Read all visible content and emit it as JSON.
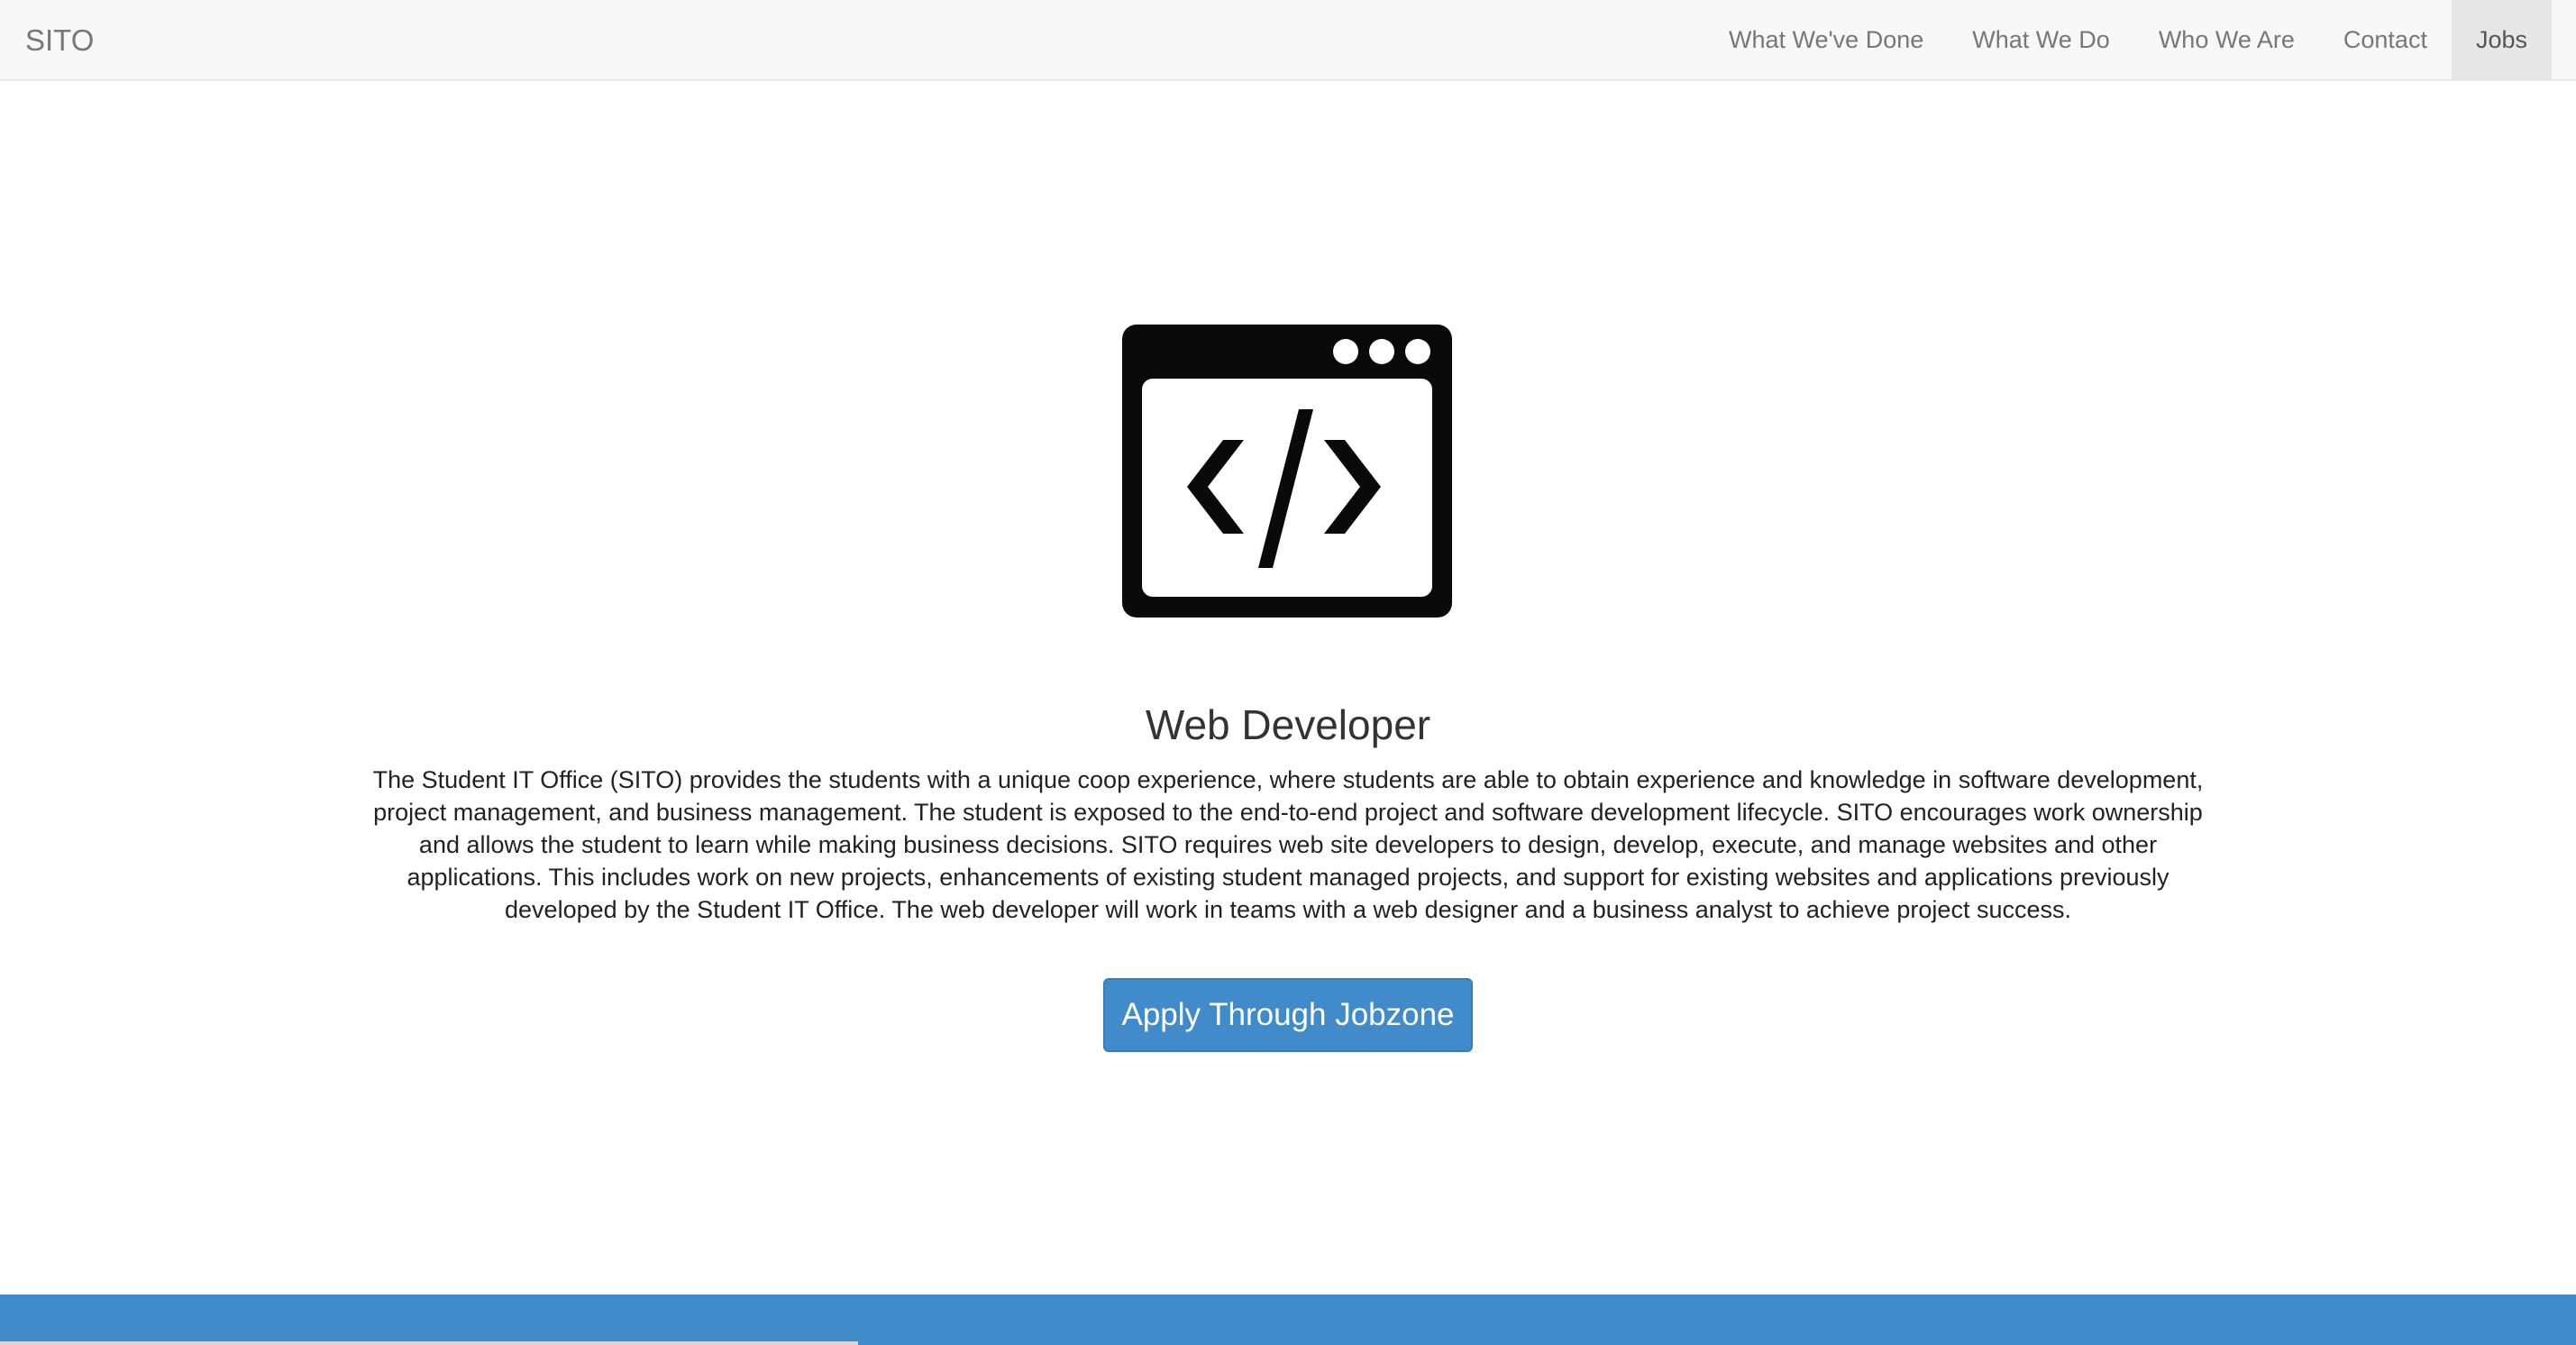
{
  "navbar": {
    "brand": "SITO",
    "items": [
      {
        "label": "What We've Done"
      },
      {
        "label": "What We Do"
      },
      {
        "label": "Who We Are"
      },
      {
        "label": "Contact"
      },
      {
        "label": "Jobs",
        "active": true
      }
    ]
  },
  "job": {
    "icon": "code-window-icon",
    "title": "Web Developer",
    "description": "The Student IT Office (SITO) provides the students with a unique coop experience, where students are able to obtain experience and knowledge in software development, project management, and business management. The student is exposed to the end-to-end project and software development lifecycle. SITO encourages work ownership and allows the student to learn while making business decisions. SITO requires web site developers to design, develop, execute, and manage websites and other applications. This includes work on new projects, enhancements of existing student managed projects, and support for existing websites and applications previously developed by the Student IT Office. The web developer will work in teams with a web designer and a business analyst to achieve project success.",
    "apply_label": "Apply Through Jobzone"
  },
  "colors": {
    "navbar_bg": "#f8f8f8",
    "nav_active_bg": "#e7e7e7",
    "nav_text": "#777777",
    "primary": "#428bca",
    "icon": "#0a0a0a"
  }
}
